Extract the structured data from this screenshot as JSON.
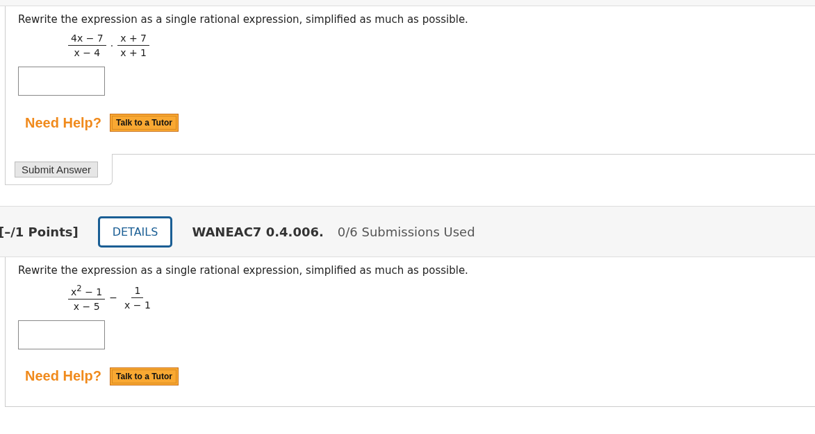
{
  "questions": [
    {
      "prompt": "Rewrite the expression as a single rational expression, simplified as much as possible.",
      "expression": [
        {
          "kind": "fraction",
          "numerator": "4x − 7",
          "denominator": "x − 4"
        },
        {
          "kind": "operator",
          "symbol": "·"
        },
        {
          "kind": "fraction",
          "numerator": "x + 7",
          "denominator": "x + 1"
        }
      ],
      "help_label": "Need Help?",
      "tutor_button": "Talk to a Tutor",
      "submit_button": "Submit Answer"
    },
    {
      "header": {
        "points": "[–/1 Points]",
        "details_button": "DETAILS",
        "problem_id": "WANEAC7 0.4.006.",
        "submissions": "0/6 Submissions Used"
      },
      "prompt": "Rewrite the expression as a single rational expression, simplified as much as possible.",
      "expression": [
        {
          "kind": "fraction",
          "numerator": "x$^{2}$ − 1",
          "denominator": "x − 5"
        },
        {
          "kind": "operator",
          "symbol": "−"
        },
        {
          "kind": "fraction",
          "numerator": "1",
          "denominator": "x − 1"
        }
      ],
      "help_label": "Need Help?",
      "tutor_button": "Talk to a Tutor"
    }
  ]
}
